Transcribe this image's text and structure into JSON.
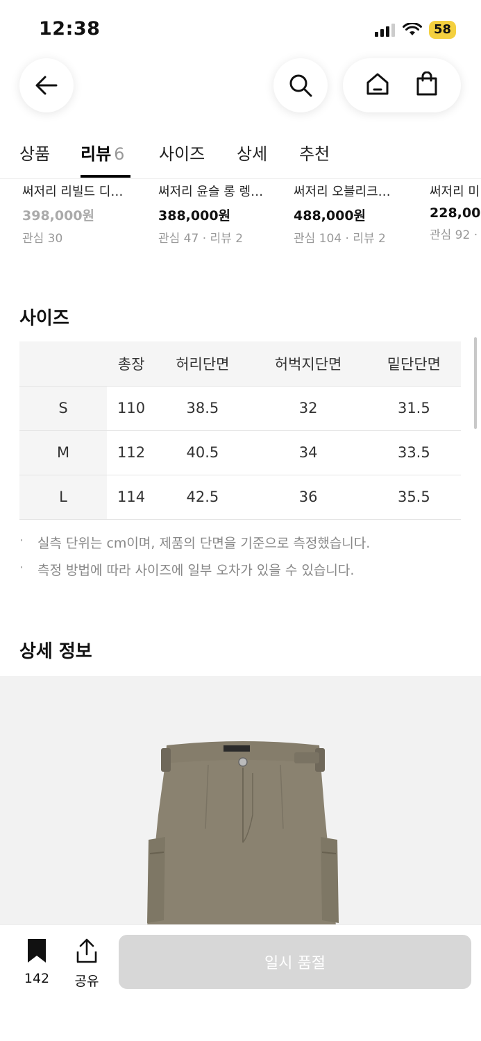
{
  "status": {
    "time": "12:38",
    "battery": "58"
  },
  "tabs": [
    {
      "label": "상품"
    },
    {
      "label": "리뷰",
      "count": "6"
    },
    {
      "label": "사이즈"
    },
    {
      "label": "상세"
    },
    {
      "label": "추천"
    }
  ],
  "recommended": [
    {
      "name": "써저리 리빌드 디…",
      "price": "398,000원",
      "meta": "관심 30"
    },
    {
      "name": "써저리 윤슬 롱 렝…",
      "price": "388,000원",
      "meta": "관심 47 · 리뷰 2"
    },
    {
      "name": "써저리 오블리크…",
      "price": "488,000원",
      "meta": "관심 104 · 리뷰 2"
    },
    {
      "name": "써저리 미",
      "price": "228,00",
      "meta": "관심 92 ·"
    }
  ],
  "size_section": {
    "title": "사이즈",
    "columns": [
      "총장",
      "허리단면",
      "허벅지단면",
      "밑단단면"
    ],
    "rows": [
      {
        "size": "S",
        "values": [
          "110",
          "38.5",
          "32",
          "31.5"
        ]
      },
      {
        "size": "M",
        "values": [
          "112",
          "40.5",
          "34",
          "33.5"
        ]
      },
      {
        "size": "L",
        "values": [
          "114",
          "42.5",
          "36",
          "35.5"
        ]
      }
    ],
    "notes": [
      "실측 단위는 cm이며, 제품의 단면을 기준으로 측정했습니다.",
      "측정 방법에 따라 사이즈에 일부 오차가 있을 수 있습니다."
    ]
  },
  "detail_section": {
    "title": "상세 정보"
  },
  "bottom_bar": {
    "bookmark_count": "142",
    "share_label": "공유",
    "soldout_label": "일시 품절"
  },
  "colors": {
    "soldout_bg": "#d7d7d7",
    "battery": "#f4d03f",
    "pants": "#8a8270"
  }
}
